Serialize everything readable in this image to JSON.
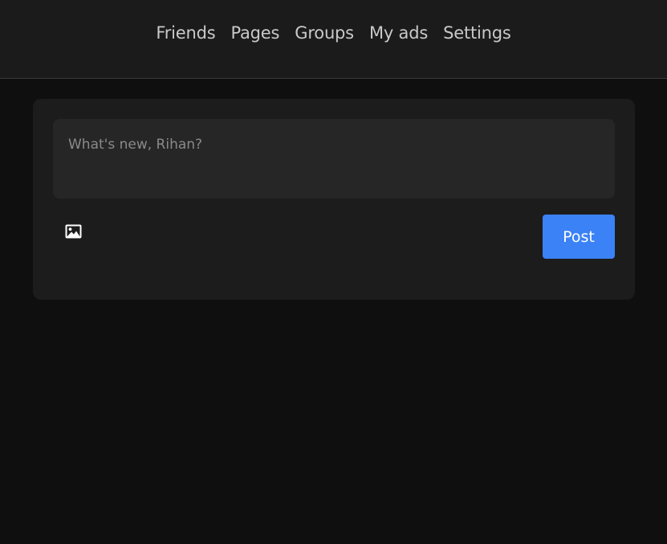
{
  "nav": {
    "items": [
      {
        "label": "Friends"
      },
      {
        "label": "Pages"
      },
      {
        "label": "Groups"
      },
      {
        "label": "My ads"
      },
      {
        "label": "Settings"
      }
    ]
  },
  "composer": {
    "placeholder": "What's new, Rihan?",
    "value": "",
    "image_icon": "image-icon",
    "post_label": "Post",
    "accent_color": "#3b82f6"
  },
  "colors": {
    "background": "#0f0f0f",
    "header": "#1b1b1b",
    "card": "#1c1c1c",
    "input": "#262626"
  }
}
